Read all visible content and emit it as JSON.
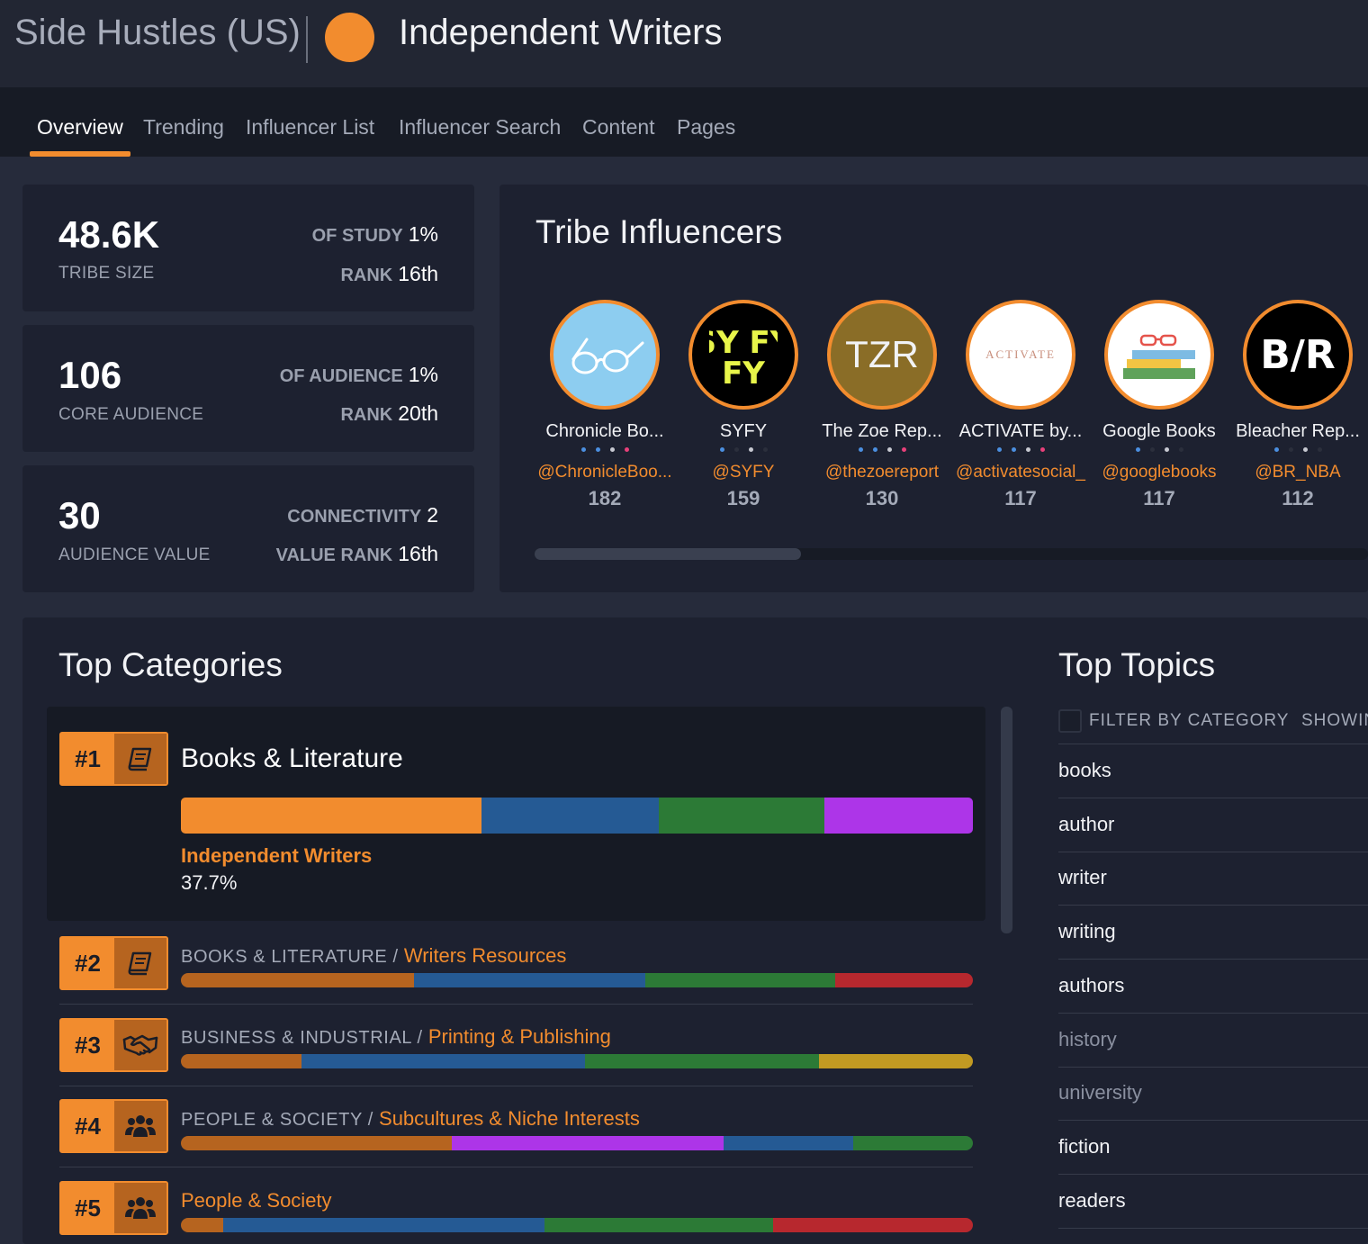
{
  "header": {
    "study": "Side Hustles (US)",
    "tribe": "Independent Writers",
    "tribe_color": "#f28c2e"
  },
  "tabs": [
    {
      "label": "Overview",
      "active": true
    },
    {
      "label": "Trending"
    },
    {
      "label": "Influencer List"
    },
    {
      "label": "Influencer Search"
    },
    {
      "label": "Content"
    },
    {
      "label": "Pages"
    }
  ],
  "stats": {
    "tribe_size": {
      "value": "48.6K",
      "label": "TRIBE SIZE",
      "r1_label": "OF STUDY",
      "r1_value": "1%",
      "r2_label": "RANK",
      "r2_value": "16th"
    },
    "core_audience": {
      "value": "106",
      "label": "CORE AUDIENCE",
      "r1_label": "OF AUDIENCE",
      "r1_value": "1%",
      "r2_label": "RANK",
      "r2_value": "20th"
    },
    "audience_value": {
      "value": "30",
      "label": "AUDIENCE VALUE",
      "r1_label": "CONNECTIVITY",
      "r1_value": "2",
      "r2_label": "VALUE RANK",
      "r2_value": "16th"
    }
  },
  "influencers": {
    "title": "Tribe Influencers",
    "items": [
      {
        "name": "Chronicle Bo...",
        "handle": "@ChronicleBoo...",
        "score": "182",
        "avatar_icon": "glasses-icon"
      },
      {
        "name": "SYFY",
        "handle": "@SYFY",
        "score": "159",
        "avatar_text": "SY FY"
      },
      {
        "name": "The Zoe Rep...",
        "handle": "@thezoereport",
        "score": "130",
        "avatar_text": "TZR"
      },
      {
        "name": "ACTIVATE by...",
        "handle": "@activatesocial_",
        "score": "117",
        "avatar_text": "ACTIVATE"
      },
      {
        "name": "Google Books",
        "handle": "@googlebooks",
        "score": "117",
        "avatar_icon": "books-glasses-icon"
      },
      {
        "name": "Bleacher Rep...",
        "handle": "@BR_NBA",
        "score": "112",
        "avatar_text": "B/R"
      }
    ]
  },
  "categories": {
    "title": "Top Categories",
    "items": [
      {
        "rank": "#1",
        "icon": "book-icon",
        "name": "Books & Literature",
        "highlight_tribe": "Independent Writers",
        "highlight_pct": "37.7%",
        "segments": [
          {
            "pct": 37.9,
            "color": "#f28c2e"
          },
          {
            "pct": 22.4,
            "color": "#255a94"
          },
          {
            "pct": 21.0,
            "color": "#2c7a36"
          },
          {
            "pct": 18.7,
            "color": "#ad35e8"
          }
        ]
      },
      {
        "rank": "#2",
        "icon": "book-icon",
        "parent": "BOOKS & LITERATURE",
        "child": "Writers Resources",
        "segments": [
          {
            "pct": 29.4,
            "color": "#b6641f"
          },
          {
            "pct": 29.2,
            "color": "#255a94"
          },
          {
            "pct": 24.0,
            "color": "#2c7a36"
          },
          {
            "pct": 17.4,
            "color": "#b7282e"
          }
        ]
      },
      {
        "rank": "#3",
        "icon": "handshake-icon",
        "parent": "BUSINESS & INDUSTRIAL",
        "child": "Printing & Publishing",
        "segments": [
          {
            "pct": 15.2,
            "color": "#b6641f"
          },
          {
            "pct": 35.8,
            "color": "#255a94"
          },
          {
            "pct": 29.6,
            "color": "#2c7a36"
          },
          {
            "pct": 19.4,
            "color": "#c29a22"
          }
        ]
      },
      {
        "rank": "#4",
        "icon": "people-icon",
        "parent": "PEOPLE & SOCIETY",
        "child": "Subcultures & Niche Interests",
        "segments": [
          {
            "pct": 34.2,
            "color": "#b6641f"
          },
          {
            "pct": 34.3,
            "color": "#ad35e8"
          },
          {
            "pct": 16.4,
            "color": "#255a94"
          },
          {
            "pct": 15.1,
            "color": "#2c7a36"
          }
        ]
      },
      {
        "rank": "#5",
        "icon": "people-icon",
        "parent": "",
        "child": "People & Society",
        "segments": [
          {
            "pct": 5.3,
            "color": "#b6641f"
          },
          {
            "pct": 40.6,
            "color": "#255a94"
          },
          {
            "pct": 28.9,
            "color": "#2c7a36"
          },
          {
            "pct": 25.2,
            "color": "#b7282e"
          }
        ]
      }
    ]
  },
  "topics": {
    "title": "Top Topics",
    "filter_label": "FILTER BY CATEGORY",
    "showing_label": "SHOWIN",
    "items": [
      {
        "label": "books",
        "dim": false
      },
      {
        "label": "author",
        "dim": false
      },
      {
        "label": "writer",
        "dim": false
      },
      {
        "label": "writing",
        "dim": false
      },
      {
        "label": "authors",
        "dim": false
      },
      {
        "label": "history",
        "dim": true
      },
      {
        "label": "university",
        "dim": true
      },
      {
        "label": "fiction",
        "dim": false
      },
      {
        "label": "readers",
        "dim": false
      }
    ]
  }
}
